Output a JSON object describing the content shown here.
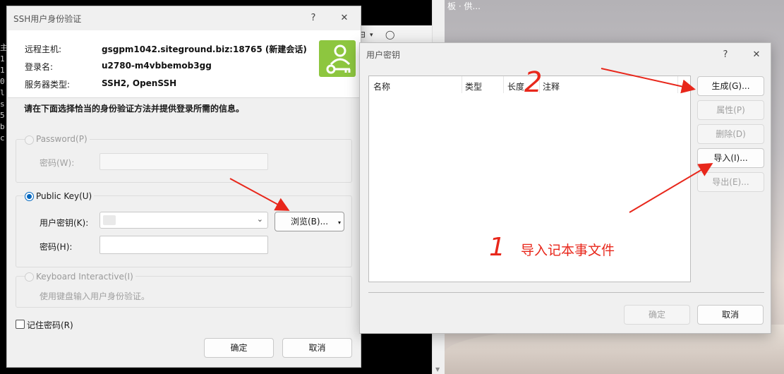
{
  "background": {
    "desktop_text": "板 · 供...",
    "terminal_glyphs": [
      "主",
      "1",
      "1",
      "0",
      "l",
      "s",
      "5",
      "b",
      "c"
    ]
  },
  "ssh_dialog": {
    "title": "SSH用户身份验证",
    "help_label": "?",
    "close_label": "✕",
    "info": {
      "host_label": "远程主机:",
      "host_value": "gsgpm1042.siteground.biz:18765 (新建会话)",
      "login_label": "登录名:",
      "login_value": "u2780-m4vbbemob3gg",
      "server_type_label": "服务器类型:",
      "server_type_value": "SSH2, OpenSSH"
    },
    "instruction": "请在下面选择恰当的身份验证方法并提供登录所需的信息。",
    "password_group": {
      "label": "Password(P)",
      "password_field_label": "密码(W):",
      "password_value": ""
    },
    "publickey_group": {
      "label": "Public Key(U)",
      "user_key_label": "用户密钥(K):",
      "user_key_value": "",
      "browse_label": "浏览(B)...",
      "passphrase_label": "密码(H):",
      "passphrase_value": ""
    },
    "keyboard_group": {
      "label": "Keyboard Interactive(I)",
      "hint": "使用键盘输入用户身份验证。"
    },
    "remember_password_label": "记住密码(R)",
    "ok_label": "确定",
    "cancel_label": "取消"
  },
  "user_key_dialog": {
    "title": "用户密钥",
    "help_label": "?",
    "close_label": "✕",
    "columns": [
      "名称",
      "类型",
      "长度",
      "注释"
    ],
    "rows": [],
    "buttons": {
      "generate": "生成(G)...",
      "properties": "属性(P)",
      "delete": "删除(D)",
      "import": "导入(I)...",
      "export": "导出(E)..."
    },
    "ok_label": "确定",
    "cancel_label": "取消"
  },
  "annotations": {
    "step_number_1": "1",
    "step_number_2": "2",
    "note": "导入记本事文件",
    "color": "#e8271b"
  },
  "colors": {
    "accent": "#0067c0",
    "key_logo": "#8dc63f"
  }
}
